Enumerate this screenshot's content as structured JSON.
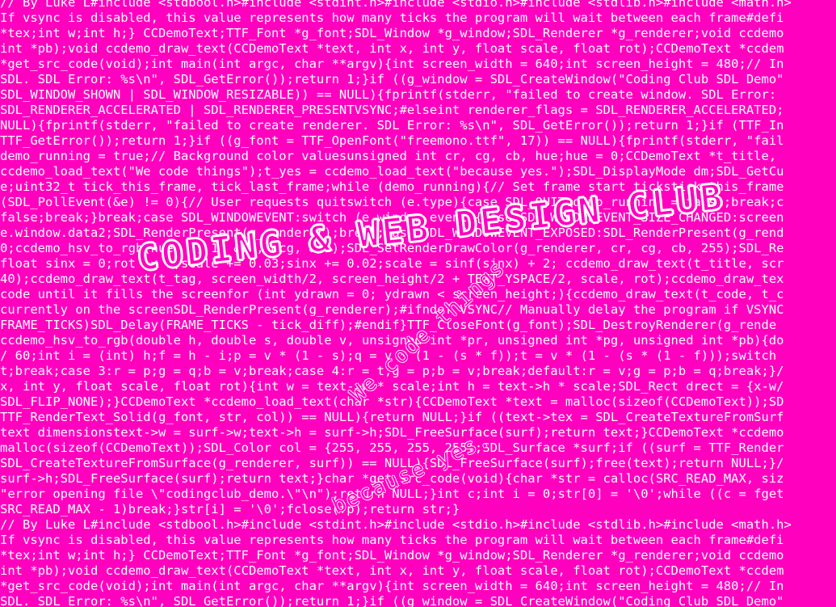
{
  "background_color": "#ff00bf",
  "text_color": "#ffffff",
  "title": "CODING & WEB DESIGN CLUB",
  "tagline": "We code things",
  "subtagline": "because yes.",
  "code_lines": [
    "// By Luke L#include <stdbool.h>#include <stdint.h>#include <stdio.h>#include <stdlib.h>#include <math.h>",
    "If vsync is disabled, this value represents how many ticks the program will wait between each frame#defi",
    "*tex;int w;int h;} CCDemoText;TTF_Font *g_font;SDL_Window *g_window;SDL_Renderer *g_renderer;void ccdemo",
    "int *pb);void ccdemo_draw_text(CCDemoText *text, int x, int y, float scale, float rot);CCDemoText *ccdem",
    "*get_src_code(void);int main(int argc, char **argv){int screen_width = 640;int screen_height = 480;// In",
    "SDL. SDL Error: %s\\n\", SDL_GetError());return 1;}if ((g_window = SDL_CreateWindow(\"Coding Club SDL Demo\"",
    "SDL_WINDOW_SHOWN | SDL_WINDOW_RESIZABLE)) == NULL){fprintf(stderr, \"failed to create window. SDL Error:",
    "SDL_RENDERER_ACCELERATED | SDL_RENDERER_PRESENTVSYNC;#elseint renderer_flags = SDL_RENDERER_ACCELERATED;",
    "NULL){fprintf(stderr, \"failed to create renderer. SDL Error: %s\\n\", SDL_GetError());return 1;}if (TTF_In",
    "TTF_GetError());return 1;}if ((g_font = TTF_OpenFont(\"freemono.ttf\", 17)) == NULL){fprintf(stderr, \"fail",
    "demo_running = true;// Background color valuesunsigned int cr, cg, cb, hue;hue = 0;CCDemoText *t_title,",
    "ccdemo_load_text(\"We code things\");t_yes = ccdemo_load_text(\"because yes.\");SDL_DisplayMode dm;SDL_GetCu",
    "e;uint32_t tick_this_frame, tick_last_frame;while (demo_running){// Set frame start tickstick_this_frame",
    "(SDL_PollEvent(&e) != 0){// User requests quitswitch (e.type){case SDL_QUIT:demo_running = false;break;c",
    "false;break;}break;case SDL_WINDOWEVENT:switch (e.window.event){case SDL_WINDOWEVENT_SIZE_CHANGED:screen",
    "e.window.data2;SDL_RenderPresent(g_renderer);break;case SDL_WINDOWEVENT_EXPOSED:SDL_RenderPresent(g_rend",
    "0;ccdemo_hsv_to_rgb(hue, 1, 1, &cr, &cg, &cb);SDL_SetRenderDrawColor(g_renderer, cr, cg, cb, 255);SDL_Re",
    "float sinx = 0;rot += 1;scale += 0.03;sinx += 0.02;scale = sinf(sinx) + 2; ccdemo_draw_text(t_title, scr",
    "40);ccdemo_draw_text(t_tag, screen_width/2, screen_height/2 + TEXT_YSPACE/2, scale, rot);ccdemo_draw_tex",
    "code until it fills the screenfor (int ydrawn = 0; ydrawn < screen_height;){ccdemo_draw_text(t_code, t_c",
    "currently on the screenSDL_RenderPresent(g_renderer);#ifndef VSYNC// Manually delay the program if VSYNC",
    "FRAME_TICKS)SDL_Delay(FRAME_TICKS - tick_diff);#endif}TTF_CloseFont(g_font);SDL_DestroyRenderer(g_rende",
    "ccdemo_hsv_to_rgb(double h, double s, double v, unsigned int *pr, unsigned int *pg, unsigned int *pb){do",
    "/ 60;int i = (int) h;f = h - i;p = v * (1 - s);q = v * (1 - (s * f));t = v * (1 - (s * (1 - f)));switch",
    "t;break;case 3:r = p;g = q;b = v;break;case 4:r = t;g = p;b = v;break;default:r = v;g = p;b = q;break;}/",
    "x, int y, float scale, float rot){int w = text->w * scale;int h = text->h * scale;SDL_Rect drect = {x-w/",
    "SDL_FLIP_NONE);}CCDemoText *ccdemo_load_text(char *str){CCDemoText *text = malloc(sizeof(CCDemoText));SD",
    "TTF_RenderText_Solid(g_font, str, col)) == NULL){return NULL;}if ((text->tex = SDL_CreateTextureFromSurf",
    "text dimensionstext->w = surf->w;text->h = surf->h;SDL_FreeSurface(surf);return text;}CCDemoText *ccdemo",
    "malloc(sizeof(CCDemoText));SDL_Color col = {255, 255, 255, 255};SDL_Surface *surf;if ((surf = TTF_Render",
    "SDL_CreateTextureFromSurface(g_renderer, surf)) == NULL){SDL_FreeSurface(surf);free(text);return NULL;}/",
    "surf->h;SDL_FreeSurface(surf);return text;}char *get_src_code(void){char *str = calloc(SRC_READ_MAX, siz",
    "\"error opening file \\\"codingclub_demo.\\\"\\n\");return NULL;}int c;int i = 0;str[0] = '\\0';while ((c = fget",
    "SRC_READ_MAX - 1)break;}str[i] = '\\0';fclose(fp);return str;}",
    "// By Luke L#include <stdbool.h>#include <stdint.h>#include <stdio.h>#include <stdlib.h>#include <math.h>",
    "If vsync is disabled, this value represents how many ticks the program will wait between each frame#defi",
    "*tex;int w;int h;} CCDemoText;TTF_Font *g_font;SDL_Window *g_window;SDL_Renderer *g_renderer;void ccdemo",
    "int *pb);void ccdemo_draw_text(CCDemoText *text, int x, int y, float scale, float rot);CCDemoText *ccdem",
    "*get_src_code(void);int main(int argc, char **argv){int screen_width = 640;int screen_height = 480;// In",
    "SDL. SDL Error: %s\\n\", SDL_GetError());return 1;}if ((g_window = SDL_CreateWindow(\"Coding Club SDL Demo\""
  ]
}
